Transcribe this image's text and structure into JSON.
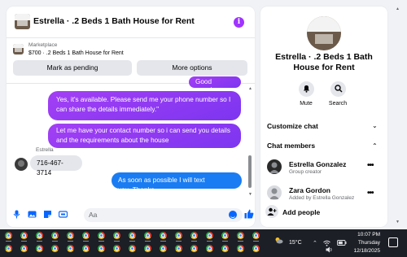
{
  "chat": {
    "title": "Estrella · .2 Beds 1 Bath House for Rent",
    "marketplace_label": "Marketplace",
    "listing": "$700 · .2 Beds 1 Bath House for Rent",
    "mark_pending": "Mark as pending",
    "more_options": "More options",
    "messages": [
      {
        "from": "me",
        "text": "Good morning"
      },
      {
        "from": "me",
        "text": "Yes, it's available. Please send me your phone number so I can share the details immediately.\""
      },
      {
        "from": "me",
        "text": "Let me have your contact number so i can send you details and the requirements about the house"
      },
      {
        "from": "them",
        "text": "716-467-3714"
      },
      {
        "from": "me",
        "text": "As soon as possible I will text you..Thanks"
      }
    ],
    "sender_name": "Estrella",
    "composer_placeholder": "Aa"
  },
  "info": {
    "title": "Estrella · .2 Beds 1 Bath House for Rent",
    "mute": "Mute",
    "search": "Search",
    "customize": "Customize chat",
    "members_header": "Chat members",
    "members": [
      {
        "name": "Estrella Gonzalez",
        "role": "Group creator"
      },
      {
        "name": "Zara Gordon",
        "role": "Added by Estrella Gonzalez"
      }
    ],
    "add_people": "Add people"
  },
  "taskbar": {
    "temperature": "15°C",
    "time": "10:07 PM",
    "day": "Thursday",
    "date": "12/18/2025"
  },
  "colors": {
    "accent_purple": "#8a2be2",
    "accent_blue": "#1a7cf2",
    "icon_blue": "#0866ff"
  }
}
